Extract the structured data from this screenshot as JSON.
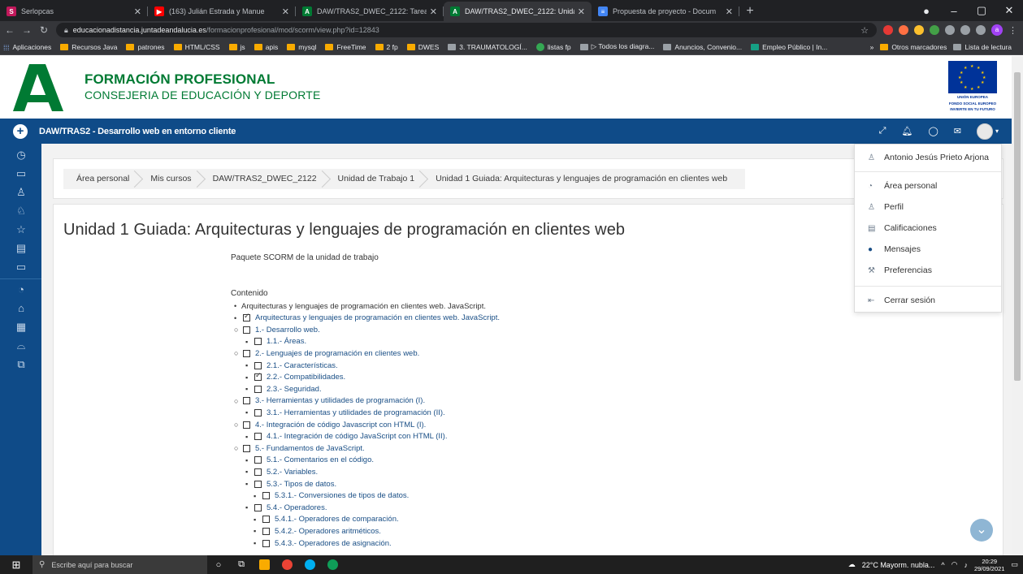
{
  "browser": {
    "tabs": [
      {
        "title": "Serlopcas",
        "color": "#c2185b",
        "glyph": "S",
        "active": false
      },
      {
        "title": "(163) Julián Estrada y Manue",
        "color": "#ff0000",
        "glyph": "▶",
        "active": false
      },
      {
        "title": "DAW/TRAS2_DWEC_2122: Tarea",
        "color": "#007a33",
        "glyph": "A",
        "active": false
      },
      {
        "title": "DAW/TRAS2_DWEC_2122: Unida",
        "color": "#007a33",
        "glyph": "A",
        "active": true
      },
      {
        "title": "Propuesta de proyecto - Docum",
        "color": "#4285f4",
        "glyph": "≡",
        "active": false
      }
    ],
    "url_host": "educacionadistancia.juntadeandalucia.es",
    "url_path": "/formacionprofesional/mod/scorm/view.php?id=12843",
    "bookmarks": [
      {
        "label": "Aplicaciones",
        "kind": "apps"
      },
      {
        "label": "Recursos Java",
        "kind": "folder"
      },
      {
        "label": "patrones",
        "kind": "folder"
      },
      {
        "label": "HTML/CSS",
        "kind": "folder"
      },
      {
        "label": "js",
        "kind": "folder"
      },
      {
        "label": "apis",
        "kind": "folder"
      },
      {
        "label": "mysql",
        "kind": "folder"
      },
      {
        "label": "FreeTime",
        "kind": "folder"
      },
      {
        "label": "2 fp",
        "kind": "folder"
      },
      {
        "label": "DWES",
        "kind": "folder"
      },
      {
        "label": "3. TRAUMATOLOGÍ...",
        "kind": "page"
      },
      {
        "label": "listas fp",
        "kind": "moodle"
      },
      {
        "label": "▷ Todos los diagra...",
        "kind": "page"
      },
      {
        "label": "Anuncios, Convenio...",
        "kind": "page"
      },
      {
        "label": "Empleo Público | In...",
        "kind": "green"
      }
    ],
    "bookmarks_right": [
      {
        "label": "»",
        "kind": "none"
      },
      {
        "label": "Otros marcadores",
        "kind": "folder"
      },
      {
        "label": "Lista de lectura",
        "kind": "page"
      }
    ]
  },
  "header": {
    "title": "FORMACIÓN PROFESIONAL",
    "subtitle": "CONSEJERIA DE EDUCACIÓN Y DEPORTE",
    "eu_caption_1": "UNIÓN EUROPEA",
    "eu_caption_2": "FONDO SOCIAL EUROPEO",
    "eu_caption_3": "INVIERTE EN TU FUTURO"
  },
  "navbar": {
    "course": "DAW/TRAS2 - Desarrollo web en entorno cliente"
  },
  "breadcrumb": [
    "Área personal",
    "Mis cursos",
    "DAW/TRAS2_DWEC_2122",
    "Unidad de Trabajo 1",
    "Unidad 1 Guiada: Arquitecturas y lenguajes de programación en clientes web"
  ],
  "main": {
    "title": "Unidad 1 Guiada: Arquitecturas y lenguajes de programación en clientes web",
    "intro": "Paquete SCORM de la unidad de trabajo",
    "toc_heading": "Contenido"
  },
  "toc": [
    {
      "label": "Arquitecturas y lenguajes de programación en clientes web. JavaScript.",
      "level": 0,
      "checkbox": false,
      "checked": false,
      "link": false
    },
    {
      "label": "Arquitecturas y lenguajes de programación en clientes web. JavaScript.",
      "level": 0,
      "checkbox": true,
      "checked": true,
      "link": true
    },
    {
      "label": "1.- Desarrollo web.",
      "level": 1,
      "checkbox": true,
      "checked": false,
      "link": true
    },
    {
      "label": "1.1.- Áreas.",
      "level": 2,
      "checkbox": true,
      "checked": false,
      "link": true
    },
    {
      "label": "2.- Lenguajes de programación en clientes web.",
      "level": 1,
      "checkbox": true,
      "checked": false,
      "link": true
    },
    {
      "label": "2.1.- Características.",
      "level": 2,
      "checkbox": true,
      "checked": false,
      "link": true
    },
    {
      "label": "2.2.- Compatibilidades.",
      "level": 2,
      "checkbox": true,
      "checked": true,
      "link": true
    },
    {
      "label": "2.3.- Seguridad.",
      "level": 2,
      "checkbox": true,
      "checked": false,
      "link": true
    },
    {
      "label": "3.- Herramientas y utilidades de programación (I).",
      "level": 1,
      "checkbox": true,
      "checked": false,
      "link": true
    },
    {
      "label": "3.1.- Herramientas y utilidades de programación (II).",
      "level": 2,
      "checkbox": true,
      "checked": false,
      "link": true
    },
    {
      "label": "4.- Integración de código Javascript con HTML (I).",
      "level": 1,
      "checkbox": true,
      "checked": false,
      "link": true
    },
    {
      "label": "4.1.- Integración de código JavaScript con HTML (II).",
      "level": 2,
      "checkbox": true,
      "checked": false,
      "link": true
    },
    {
      "label": "5.- Fundamentos de JavaScript.",
      "level": 1,
      "checkbox": true,
      "checked": false,
      "link": true
    },
    {
      "label": "5.1.- Comentarios en el código.",
      "level": 2,
      "checkbox": true,
      "checked": false,
      "link": true
    },
    {
      "label": "5.2.- Variables.",
      "level": 2,
      "checkbox": true,
      "checked": false,
      "link": true
    },
    {
      "label": "5.3.- Tipos de datos.",
      "level": 2,
      "checkbox": true,
      "checked": false,
      "link": true
    },
    {
      "label": "5.3.1.- Conversiones de tipos de datos.",
      "level": 3,
      "checkbox": true,
      "checked": false,
      "link": true
    },
    {
      "label": "5.4.- Operadores.",
      "level": 2,
      "checkbox": true,
      "checked": false,
      "link": true
    },
    {
      "label": "5.4.1.- Operadores de comparación.",
      "level": 3,
      "checkbox": true,
      "checked": false,
      "link": true
    },
    {
      "label": "5.4.2.- Operadores aritméticos.",
      "level": 3,
      "checkbox": true,
      "checked": false,
      "link": true
    },
    {
      "label": "5.4.3.- Operadores de asignación.",
      "level": 3,
      "checkbox": true,
      "checked": false,
      "link": true
    }
  ],
  "usermenu": {
    "name": "Antonio Jesús Prieto Arjona",
    "items": [
      "Área personal",
      "Perfil",
      "Calificaciones",
      "Mensajes",
      "Preferencias"
    ],
    "logout": "Cerrar sesión"
  },
  "taskbar": {
    "search_placeholder": "Escribe aquí para buscar",
    "weather": "22°C  Mayorm. nubla...",
    "time": "20:29",
    "date": "29/09/2021"
  },
  "colors": {
    "navbar": "#0f4b88",
    "brand_green": "#007a33",
    "link": "#1a4f86"
  }
}
